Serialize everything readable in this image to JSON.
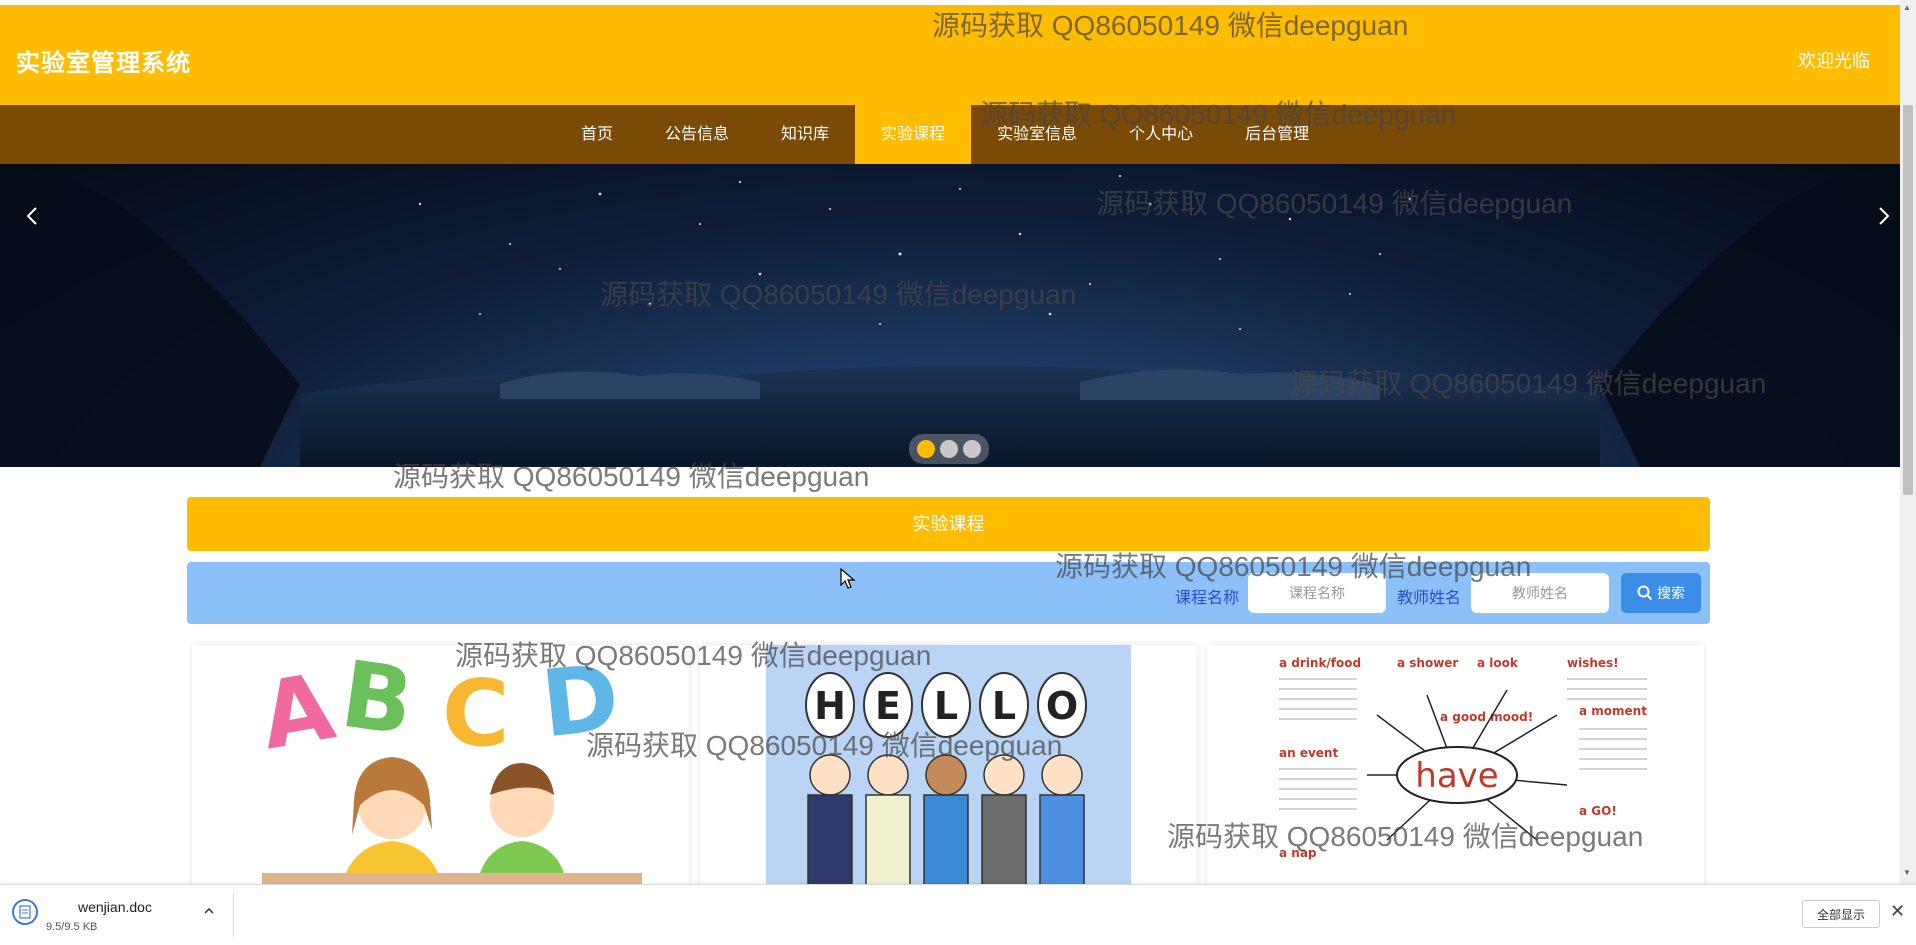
{
  "header": {
    "title": "实验室管理系统",
    "welcome": "欢迎光临"
  },
  "nav": {
    "items": [
      {
        "label": "首页"
      },
      {
        "label": "公告信息"
      },
      {
        "label": "知识库"
      },
      {
        "label": "实验课程",
        "active": true
      },
      {
        "label": "实验室信息"
      },
      {
        "label": "个人中心"
      },
      {
        "label": "后台管理"
      }
    ]
  },
  "banner": {
    "prev_icon": "chevron-left-icon",
    "next_icon": "chevron-right-icon",
    "slide_count": 3,
    "active_slide": 1
  },
  "section": {
    "title": "实验课程"
  },
  "search": {
    "course_label": "课程名称",
    "course_placeholder": "课程名称",
    "teacher_label": "教师姓名",
    "teacher_placeholder": "教师姓名",
    "button_label": "搜索",
    "button_icon": "search-icon"
  },
  "watermark": "源码获取 QQ86050149 微信deepguan",
  "download": {
    "file_name": "wenjian.doc",
    "file_size": "9.5/9.5 KB",
    "show_all": "全部显示",
    "close_icon": "close-icon"
  },
  "colors": {
    "header": "#ffbc00",
    "nav": "#7a4a06",
    "search_bar": "#8cc0f8",
    "search_button": "#3a8ee8",
    "label_blue": "#2451c8"
  }
}
